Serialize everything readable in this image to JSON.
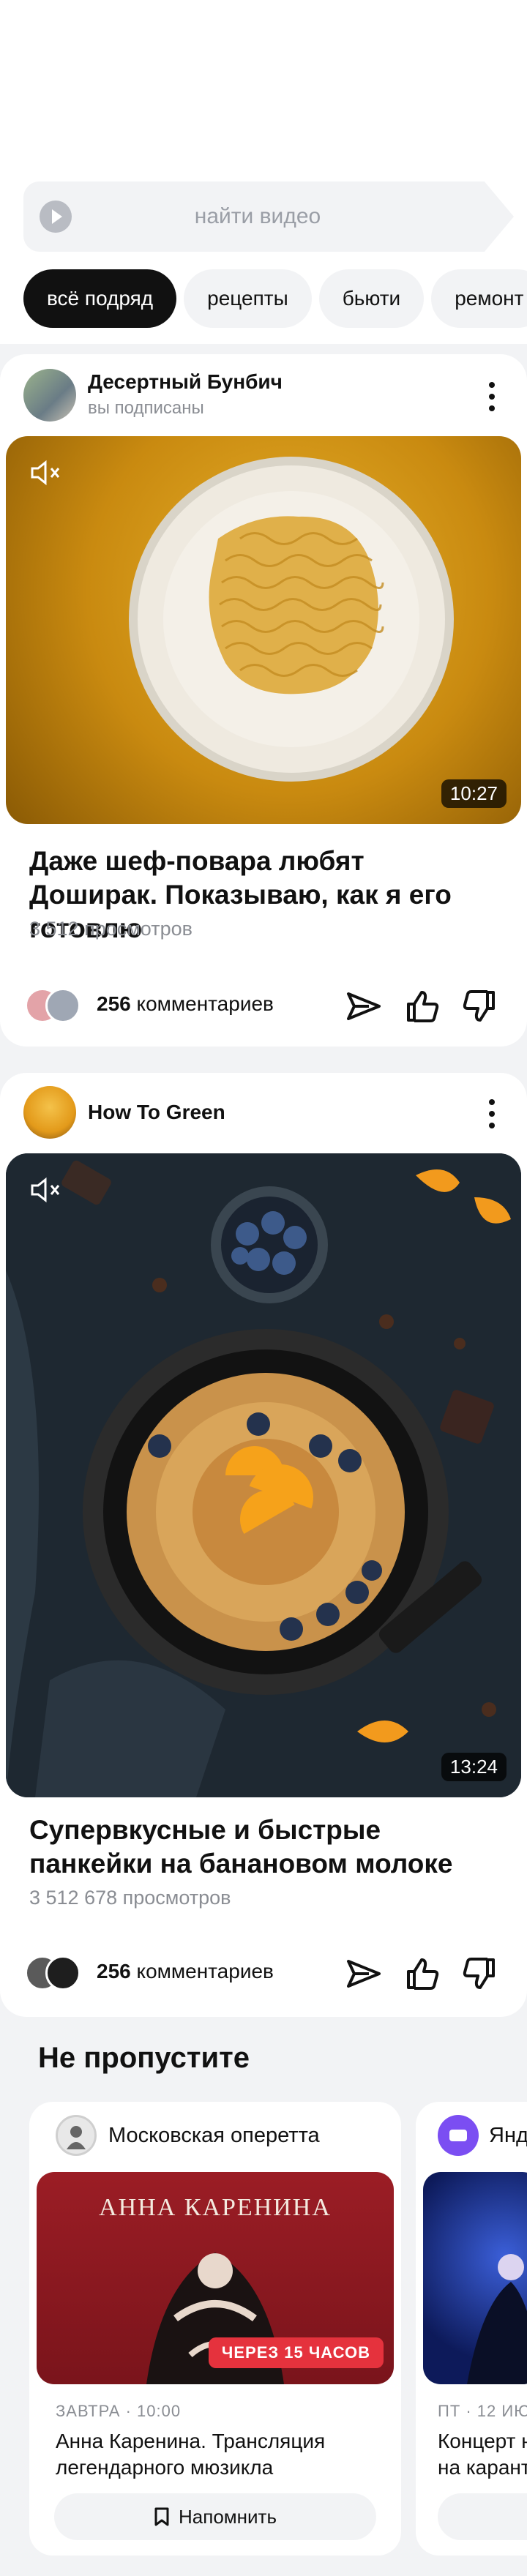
{
  "search": {
    "placeholder": "найти видео"
  },
  "chips": [
    "всё подряд",
    "рецепты",
    "бьюти",
    "ремонт"
  ],
  "videos": [
    {
      "channel": "Десертный Бунбич",
      "subtitle": "вы подписаны",
      "duration": "10:27",
      "title": "Даже шеф-повара любят Доширак. Показываю, как я его готовлю",
      "views": "3 512 просмотров",
      "comments_count": "256",
      "comments_label": "комментариев"
    },
    {
      "channel": "How To Green",
      "subtitle": "",
      "duration": "13:24",
      "title": "Супервкусные и быстрые панкейки на банановом молоке",
      "views": "3 512 678 просмотров",
      "comments_count": "256",
      "comments_label": "комментариев"
    }
  ],
  "dont_miss": {
    "title": "Не пропустите",
    "events": [
      {
        "org": "Московская оперетта",
        "poster_title": "АННА КАРЕНИНА",
        "badge": "ЧЕРЕЗ 15 ЧАСОВ",
        "date": "ЗАВТРА · 10:00",
        "title": "Анна Каренина. Трансляция легендарного мюзикла",
        "button": "Напомнить"
      },
      {
        "org": "Янд",
        "date": "ПТ · 12 ИЮ",
        "title": "Концерт н на карант"
      }
    ]
  },
  "icons": {
    "search": "play-icon",
    "mute": "mute-icon",
    "more": "more-vertical-icon",
    "share": "share-icon",
    "like": "like-icon",
    "dislike": "dislike-icon",
    "remind": "bookmark-icon"
  }
}
